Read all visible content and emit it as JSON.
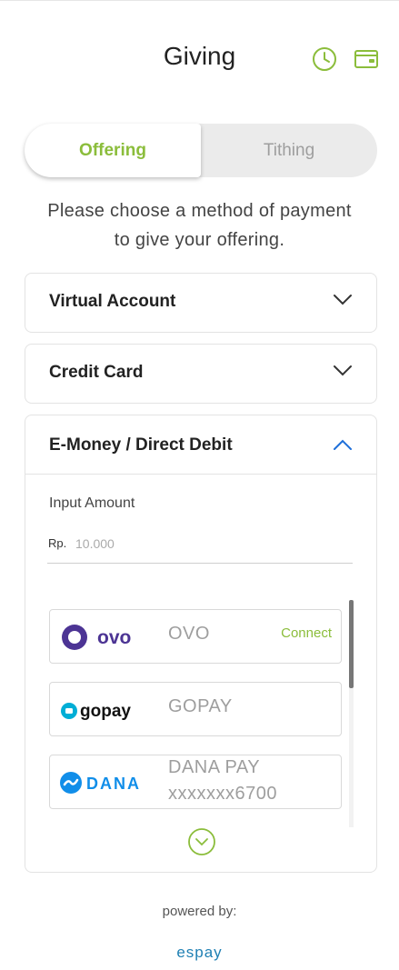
{
  "header": {
    "title": "Giving",
    "history_icon": "history-clock-icon",
    "wallet_icon": "wallet-icon"
  },
  "tabs": [
    {
      "label": "Offering",
      "active": true
    },
    {
      "label": "Tithing",
      "active": false
    }
  ],
  "instruction": {
    "line1": "Please choose a method of payment",
    "line2": "to give your offering."
  },
  "payment_methods": [
    {
      "label": "Virtual Account",
      "expanded": false
    },
    {
      "label": "Credit Card",
      "expanded": false
    },
    {
      "label": "E-Money / Direct Debit",
      "expanded": true
    }
  ],
  "emoney": {
    "amount_label": "Input Amount",
    "currency": "Rp.",
    "amount_placeholder": "10.000",
    "wallets": [
      {
        "logo_text": "ovo",
        "name": "OVO",
        "action": "Connect"
      },
      {
        "logo_text": "gopay",
        "name": "GOPAY"
      },
      {
        "logo_text": "DANA",
        "name": "DANA PAY",
        "account": "xxxxxxx6700"
      }
    ]
  },
  "footer": {
    "powered_by": "powered by:",
    "brand": "espay"
  },
  "colors": {
    "accent_green": "#8bbd3b",
    "ovo_purple": "#4c3494",
    "gopay_cyan": "#00aed6",
    "dana_blue": "#118ee9",
    "chevron_up_blue": "#1e6fd9",
    "espay_blue": "#1e7fb3"
  }
}
